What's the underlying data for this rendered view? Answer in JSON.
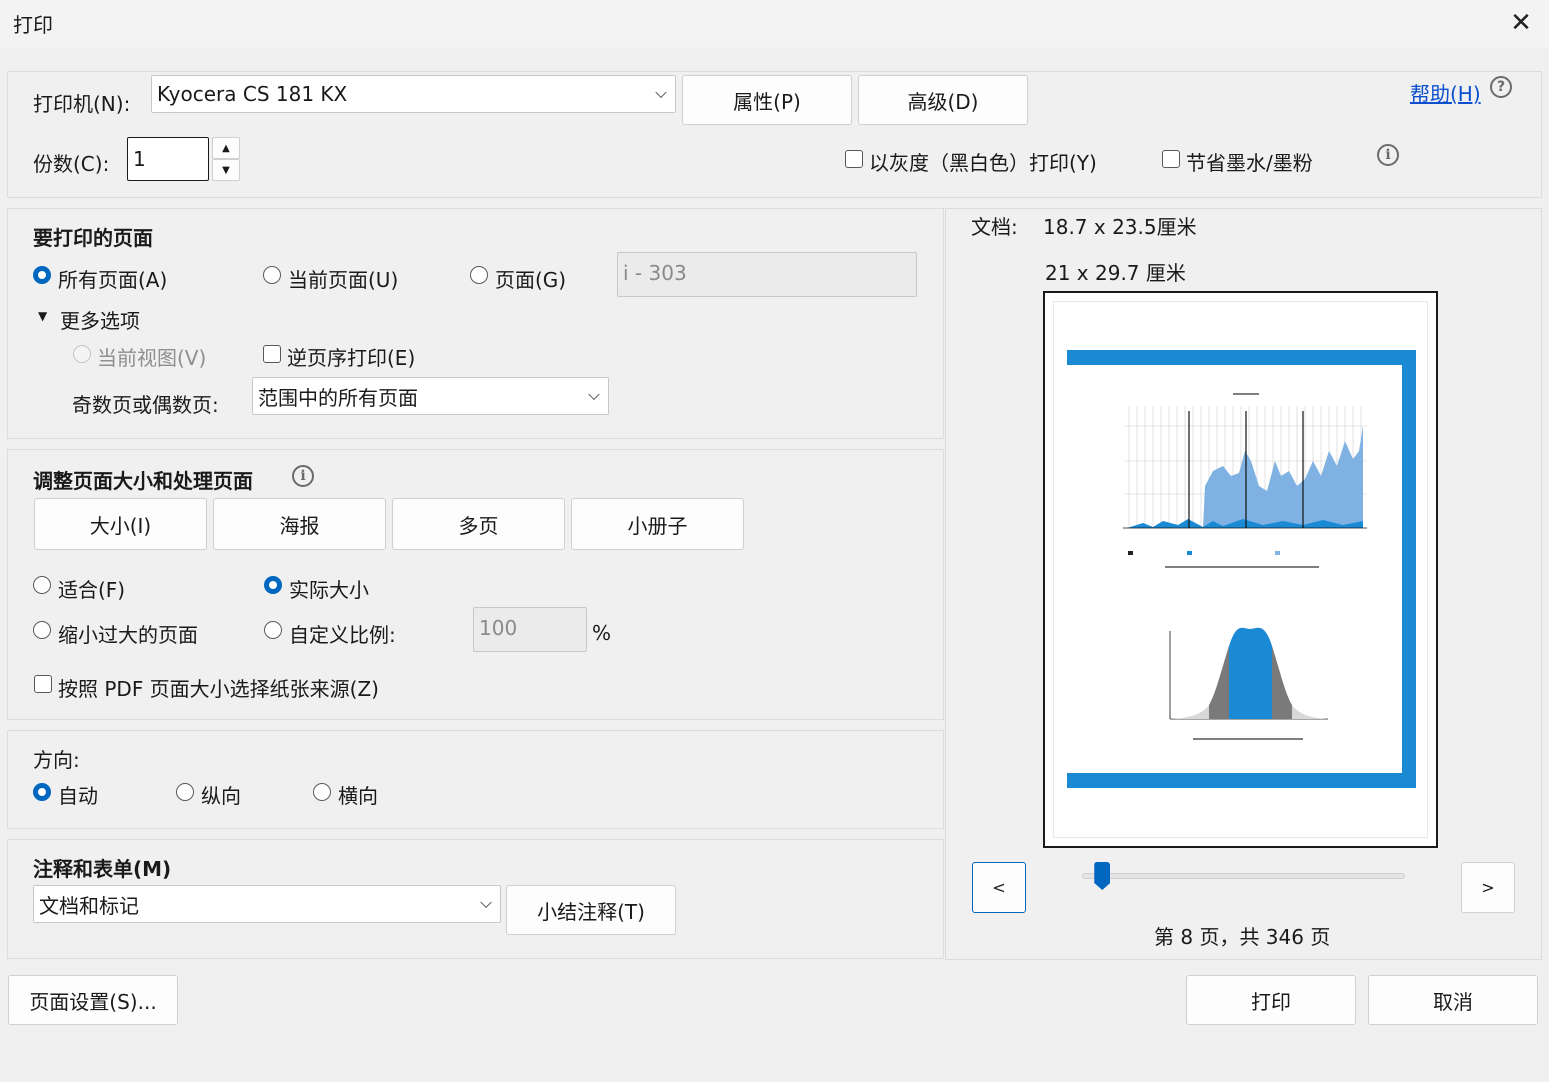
{
  "window": {
    "title": "打印",
    "close_symbol": "✕"
  },
  "printer": {
    "label": "打印机(N):",
    "value": "Kyocera CS 181 KX",
    "properties_btn": "属性(P)",
    "advanced_btn": "高级(D)",
    "help_link": "帮助(H)",
    "help_icon": "?"
  },
  "copies": {
    "label": "份数(C):",
    "value": "1",
    "up_arrow": "▲",
    "down_arrow": "▼"
  },
  "options": {
    "grayscale": "以灰度（黑白色）打印(Y)",
    "save_ink": "节省墨水/墨粉",
    "info_icon": "i"
  },
  "pages": {
    "heading": "要打印的页面",
    "all": "所有页面(A)",
    "current": "当前页面(U)",
    "page": "页面(G)",
    "range_placeholder": "i - 303",
    "more_options": "更多选项",
    "more_arrow": "▼",
    "current_view": "当前视图(V)",
    "reverse": "逆页序打印(E)",
    "odd_even_label": "奇数页或偶数页:",
    "odd_even_value": "范围中的所有页面"
  },
  "sizing": {
    "heading": "调整页面大小和处理页面",
    "info_icon": "i",
    "tabs": [
      "大小(I)",
      "海报",
      "多页",
      "小册子"
    ],
    "fit": "适合(F)",
    "actual": "实际大小",
    "shrink": "缩小过大的页面",
    "custom": "自定义比例:",
    "scale_value": "100",
    "percent": "%",
    "paper_source": "按照 PDF 页面大小选择纸张来源(Z)"
  },
  "orientation": {
    "heading": "方向:",
    "auto": "自动",
    "portrait": "纵向",
    "landscape": "横向"
  },
  "comments": {
    "heading": "注释和表单(M)",
    "value": "文档和标记",
    "summarize_btn": "小结注释(T)"
  },
  "preview": {
    "doc_label": "文档:",
    "doc_size": "18.7 x 23.5厘米",
    "paper_size": "21 x 29.7 厘米",
    "prev": "<",
    "next": ">",
    "page_info": "第 8 页，共 346 页",
    "slider_fraction": 0.04
  },
  "footer": {
    "page_setup": "页面设置(S)...",
    "print": "打印",
    "cancel": "取消"
  },
  "colors": {
    "accent": "#0067c0",
    "preview_blue": "#1a8ad4"
  }
}
